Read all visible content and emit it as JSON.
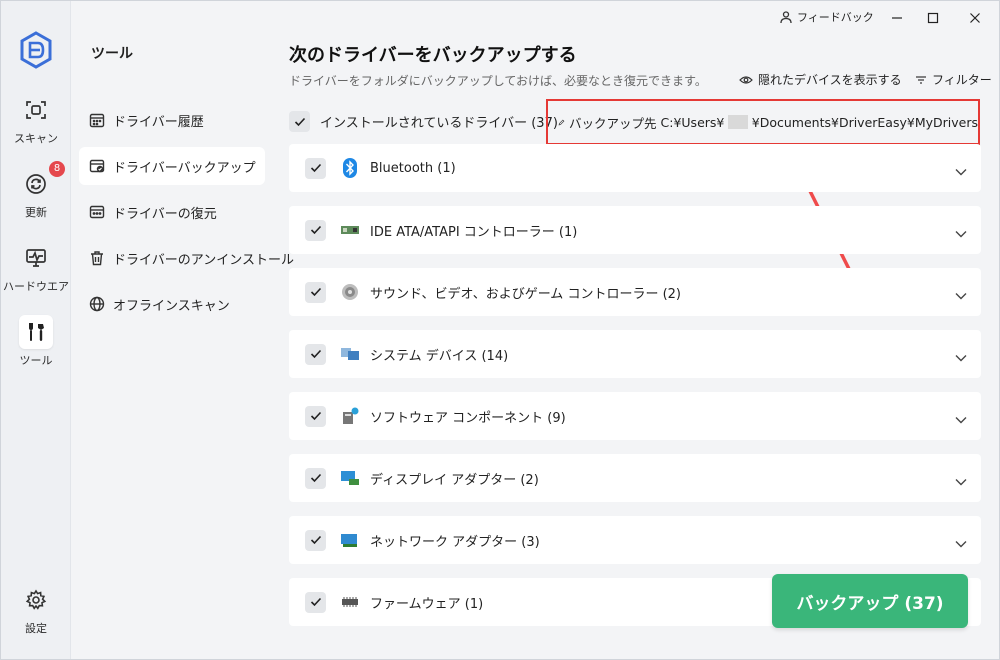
{
  "titlebar": {
    "feedback_label": "フィードバック"
  },
  "rail": {
    "items": [
      {
        "label": "スキャン",
        "icon": "scan-icon"
      },
      {
        "label": "更新",
        "icon": "refresh-icon",
        "badge": "8"
      },
      {
        "label": "ハードウエア",
        "icon": "hardware-icon"
      },
      {
        "label": "ツール",
        "icon": "tools-icon",
        "active": true
      },
      {
        "label": "設定",
        "icon": "gear-icon"
      }
    ]
  },
  "sidebar": {
    "title": "ツール",
    "items": [
      {
        "label": "ドライバー履歴",
        "icon": "calendar-icon"
      },
      {
        "label": "ドライバーバックアップ",
        "icon": "backup-icon",
        "active": true
      },
      {
        "label": "ドライバーの復元",
        "icon": "restore-icon"
      },
      {
        "label": "ドライバーのアンインストール",
        "icon": "trash-icon"
      },
      {
        "label": "オフラインスキャン",
        "icon": "globe-icon"
      }
    ]
  },
  "main": {
    "title": "次のドライバーをバックアップする",
    "subtitle": "ドライバーをフォルダにバックアップしておけば、必要なとき復元できます。",
    "show_hidden_label": "隠れたデバイスを表示する",
    "filter_label": "フィルター",
    "installed_label": "インストールされているドライバー (37)",
    "backup_dest": {
      "label": "バックアップ先",
      "path_prefix": "C:¥Users¥",
      "path_suffix": "¥Documents¥DriverEasy¥MyDrivers"
    },
    "categories": [
      {
        "label": "Bluetooth (1)",
        "icon": "bluetooth-icon"
      },
      {
        "label": "IDE ATA/ATAPI コントローラー (1)",
        "icon": "ide-controller-icon"
      },
      {
        "label": "サウンド、ビデオ、およびゲーム コントローラー (2)",
        "icon": "speaker-icon"
      },
      {
        "label": "システム デバイス (14)",
        "icon": "system-device-icon"
      },
      {
        "label": "ソフトウェア コンポーネント (9)",
        "icon": "software-component-icon"
      },
      {
        "label": "ディスプレイ アダプター (2)",
        "icon": "display-adapter-icon"
      },
      {
        "label": "ネットワーク アダプター (3)",
        "icon": "network-adapter-icon"
      },
      {
        "label": "ファームウェア (1)",
        "icon": "firmware-icon"
      }
    ],
    "backup_button": "バックアップ (37)"
  },
  "colors": {
    "accent_green": "#3ab67a",
    "highlight_red": "#e53935",
    "badge_red": "#e5484d",
    "bluetooth_blue": "#1e88e5"
  }
}
